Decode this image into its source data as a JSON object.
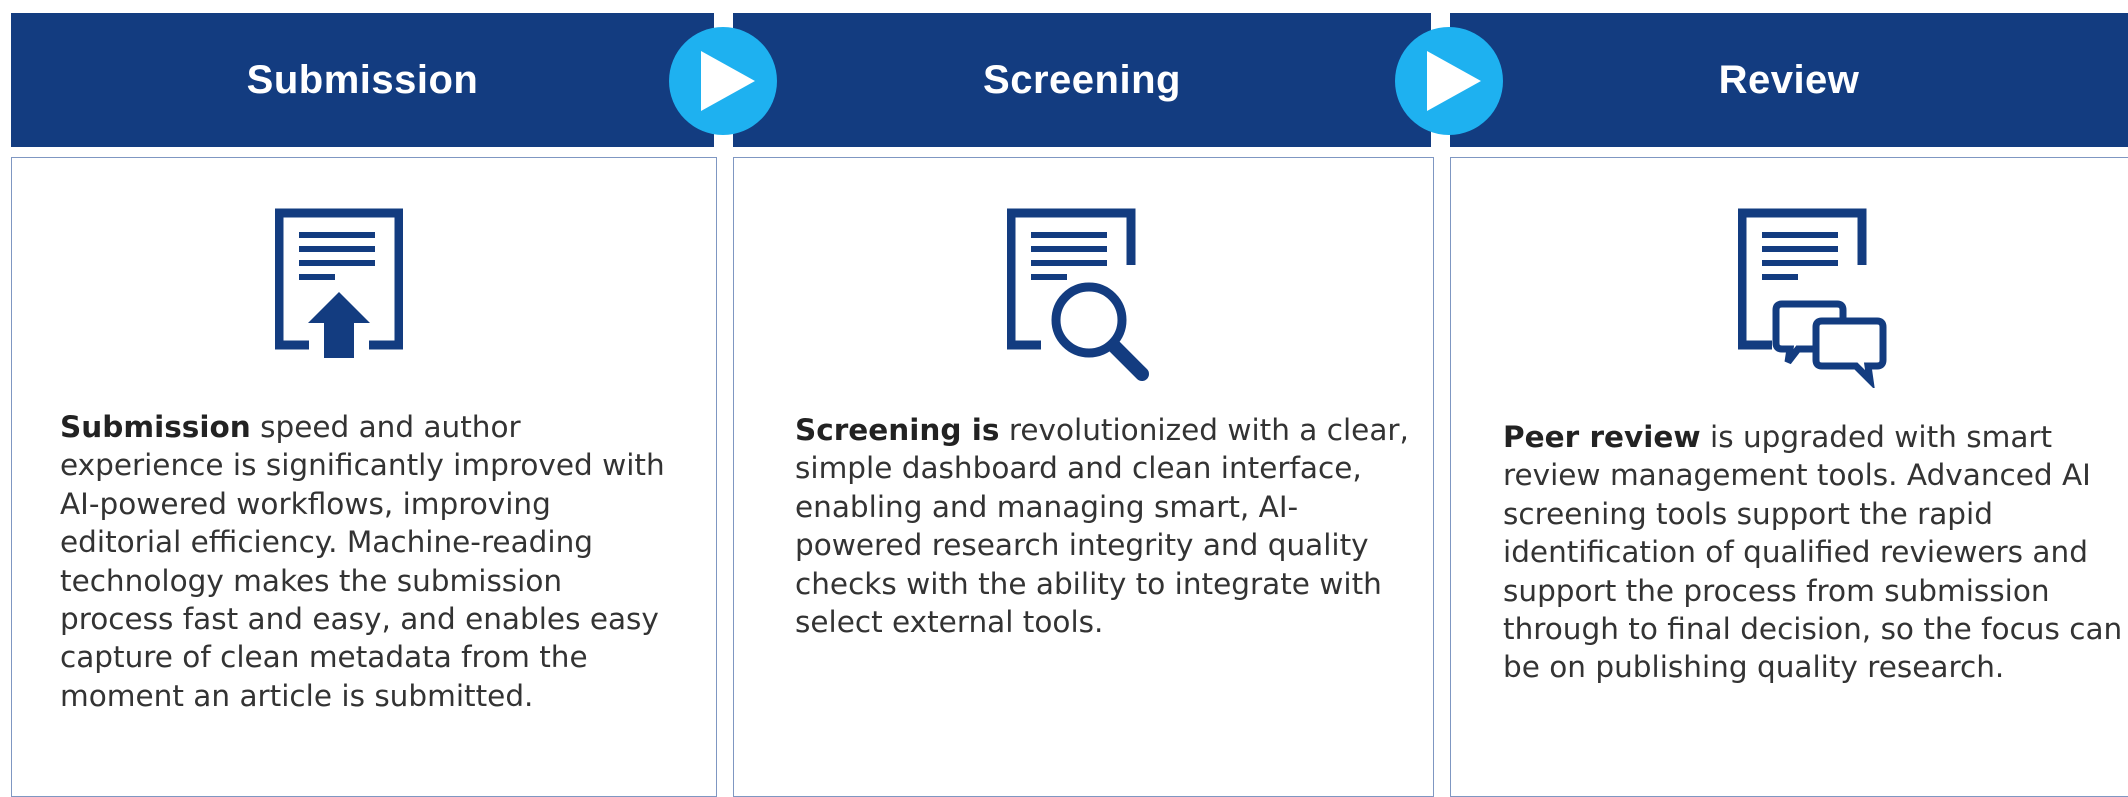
{
  "colors": {
    "header_bg": "#133c80",
    "header_text": "#ffffff",
    "arrow": "#1eb1f0",
    "card_border": "#7f97c2",
    "icon": "#133c80",
    "body_text": "#333333"
  },
  "steps": [
    {
      "title": "Submission",
      "icon": "document-upload-icon",
      "description_bold": "Submission",
      "description_rest": " speed and author experience is significantly improved with AI-powered workflows, improving editorial efficiency. Machine-reading technology makes the submission process fast and easy, and enables easy capture of clean metadata from the moment an article is submitted."
    },
    {
      "title": "Screening",
      "icon": "document-search-icon",
      "description_bold": "Screening is",
      "description_rest": " revolutionized with a clear, simple dashboard and clean interface, enabling and managing smart, AI-powered research integrity and quality checks with the ability to integrate with select external tools."
    },
    {
      "title": "Review",
      "icon": "document-comments-icon",
      "description_bold": "Peer review",
      "description_rest": " is upgraded with smart review management tools. Advanced AI screening tools support the rapid identification of qualified reviewers and support the process from submission through to final decision, so the focus can be on publishing quality research."
    }
  ],
  "connectors": [
    "arrow-right-icon",
    "arrow-right-icon"
  ]
}
